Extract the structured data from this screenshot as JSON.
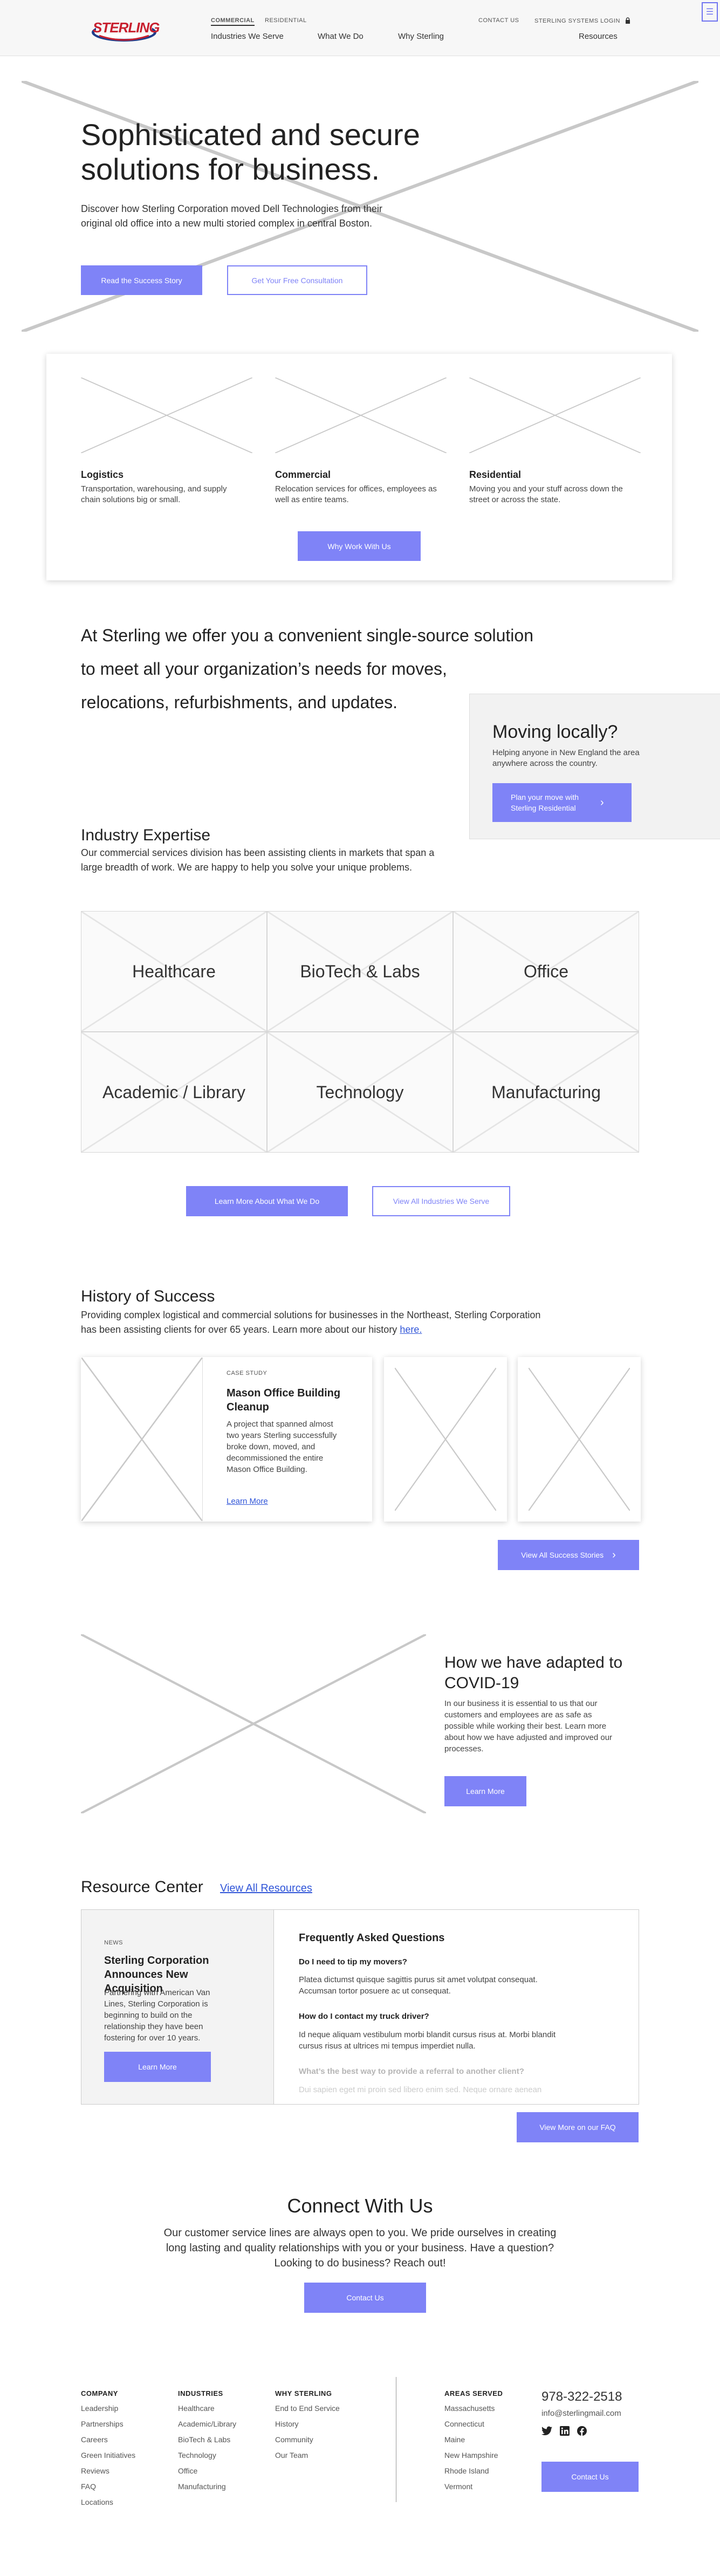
{
  "header": {
    "brand": "STERLING",
    "top_links": [
      "COMMERCIAL",
      "RESIDENTIAL"
    ],
    "utility": {
      "contact": "CONTACT US",
      "login": "STERLING SYSTEMS LOGIN"
    },
    "nav": [
      "Industries We Serve",
      "What We Do",
      "Why Sterling",
      "Resources"
    ]
  },
  "hero": {
    "title": "Sophisticated and secure solutions for business.",
    "body": "Discover how Sterling Corporation moved Dell Technologies from their original old office into a new multi storied complex in central Boston.",
    "primary_cta": "Read the Success Story",
    "secondary_cta": "Get Your Free Consultation"
  },
  "services": {
    "items": [
      {
        "title": "Logistics",
        "desc": "Transportation, warehousing, and supply chain solutions big or small."
      },
      {
        "title": "Commercial",
        "desc": "Relocation services for offices, employees as well as entire teams."
      },
      {
        "title": "Residential",
        "desc": "Moving you and your stuff across down the street or across the state."
      }
    ],
    "cta": "Why Work With Us"
  },
  "intro": {
    "line1": "At Sterling we offer you a convenient single-source solution",
    "line2": "to meet all your organization’s needs for moves,",
    "line3": "relocations, refurbishments, and updates."
  },
  "moving": {
    "title": "Moving locally?",
    "body": "Helping anyone in New England the area anywhere across the country.",
    "cta": "Plan your move with Sterling Residential"
  },
  "industry": {
    "title": "Industry Expertise",
    "body": "Our commercial services division has been assisting clients in markets that span a large breadth of work. We are happy to help you solve your unique problems.",
    "cells": [
      "Healthcare",
      "BioTech & Labs",
      "Office",
      "Academic / Library",
      "Technology",
      "Manufacturing"
    ],
    "primary_cta": "Learn More About What We Do",
    "secondary_cta": "View All Industries We Serve"
  },
  "history": {
    "title": "History of Success",
    "body": "Providing complex logistical and commercial solutions for businesses in the Northeast, Sterling Corporation has been assisting clients for over 65 years. Learn more about our history",
    "link": "here.",
    "case_label": "CASE STUDY",
    "case_title": "Mason Office Building Cleanup",
    "case_body": "A project that spanned almost two years Sterling successfully broke down, moved, and decommissioned the entire Mason Office Building.",
    "case_link": "Learn More",
    "cta": "View All Success Stories"
  },
  "covid": {
    "title": "How we have adapted to COVID-19",
    "body": "In our business it is essential to us that our customers and employees are as safe as possible while working their best. Learn more about how we have adjusted and improved our processes.",
    "cta": "Learn More"
  },
  "resources": {
    "title": "Resource Center",
    "link": "View All Resources",
    "news_label": "NEWS",
    "news_title": "Sterling Corporation Announces New Acquisition",
    "news_body": "Partnering with American Van Lines, Sterling Corporation is beginning to build on the relationship they have been fostering for over 10 years.",
    "news_cta": "Learn More",
    "faq_title": "Frequently Asked Questions",
    "faq": [
      {
        "q": "Do I need to tip my movers?",
        "a": "Platea dictumst quisque sagittis purus sit amet volutpat consequat. Accumsan tortor posuere ac ut consequat."
      },
      {
        "q": "How do I contact my truck driver?",
        "a": "Id neque aliquam vestibulum morbi blandit cursus risus at. Morbi blandit cursus risus at ultrices mi tempus imperdiet nulla."
      },
      {
        "q": "What’s the best way to provide a referral to another client?",
        "a": "Dui sapien eget mi proin sed libero enim sed. Neque ornare aenean"
      }
    ],
    "faq_cta": "View More on our FAQ"
  },
  "connect": {
    "title": "Connect With Us",
    "body": "Our customer service lines are always open to you. We pride ourselves in creating long lasting and quality relationships with you or your business. Have a question? Looking to do business? Reach out!",
    "cta": "Contact Us"
  },
  "footer": {
    "columns": [
      {
        "title": "COMPANY",
        "items": [
          "Leadership",
          "Partnerships",
          "Careers",
          "Green Initiatives",
          "Reviews",
          "FAQ",
          "Locations"
        ]
      },
      {
        "title": "INDUSTRIES",
        "items": [
          "Healthcare",
          "Academic/Library",
          "BioTech & Labs",
          "Technology",
          "Office",
          "Manufacturing"
        ]
      },
      {
        "title": "WHY STERLING",
        "items": [
          "End to End Service",
          "History",
          "Community",
          "Our Team"
        ]
      },
      {
        "title": "AREAS SERVED",
        "items": [
          "Massachusetts",
          "Connecticut",
          "Maine",
          "New Hampshire",
          "Rhode Island",
          "Vermont"
        ]
      }
    ],
    "phone": "978-322-2518",
    "email": "info@sterlingmail.com",
    "cta": "Contact Us"
  },
  "colors": {
    "accent": "#7f83f7",
    "brand_red": "#c8202f",
    "brand_blue": "#1f3d8a"
  },
  "icons": [
    "twitter-icon",
    "linkedin-icon",
    "facebook-icon",
    "lock-icon",
    "chevron-right-icon",
    "menu-icon"
  ]
}
